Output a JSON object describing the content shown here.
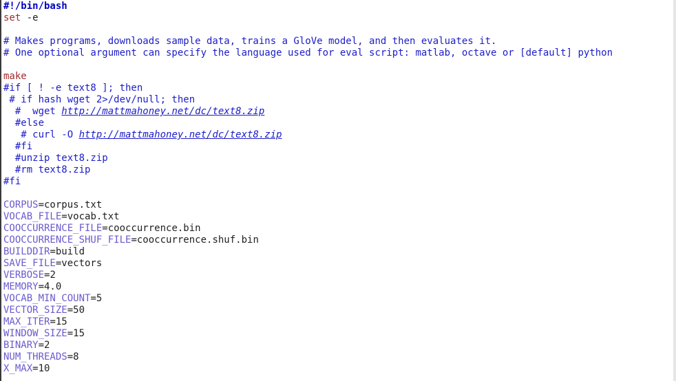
{
  "editor": {
    "lines": [
      [
        {
          "t": "#!/bin/bash",
          "c": "shebang"
        }
      ],
      [
        {
          "t": "set",
          "c": "keyword"
        },
        {
          "t": " -e",
          "c": "text"
        }
      ],
      [],
      [
        {
          "t": "# Makes programs, downloads sample data, trains a GloVe model, and then evaluates it.",
          "c": "comment"
        }
      ],
      [
        {
          "t": "# One optional argument can specify the language used for eval script: matlab, octave or [default] python",
          "c": "comment"
        }
      ],
      [],
      [
        {
          "t": "make",
          "c": "make"
        }
      ],
      [
        {
          "t": "#if [ ! -e text8 ]; then",
          "c": "comment"
        }
      ],
      [
        {
          "t": " # if hash wget 2>/dev/null; then",
          "c": "comment"
        }
      ],
      [
        {
          "t": "  #  wget ",
          "c": "comment"
        },
        {
          "t": "http://mattmahoney.net/dc/text8.zip",
          "c": "url"
        }
      ],
      [
        {
          "t": "  #else",
          "c": "comment"
        }
      ],
      [
        {
          "t": "   # curl -O ",
          "c": "comment"
        },
        {
          "t": "http://mattmahoney.net/dc/text8.zip",
          "c": "url"
        }
      ],
      [
        {
          "t": "  #fi",
          "c": "comment"
        }
      ],
      [
        {
          "t": "  #unzip text8.zip",
          "c": "comment"
        }
      ],
      [
        {
          "t": "  #rm text8.zip",
          "c": "comment"
        }
      ],
      [
        {
          "t": "#fi",
          "c": "comment"
        }
      ],
      [],
      [
        {
          "t": "CORPUS",
          "c": "varname"
        },
        {
          "t": "=corpus.txt",
          "c": "text"
        }
      ],
      [
        {
          "t": "VOCAB_FILE",
          "c": "varname"
        },
        {
          "t": "=vocab.txt",
          "c": "text"
        }
      ],
      [
        {
          "t": "COOCCURRENCE_FILE",
          "c": "varname"
        },
        {
          "t": "=cooccurrence.bin",
          "c": "text"
        }
      ],
      [
        {
          "t": "COOCCURRENCE_SHUF_FILE",
          "c": "varname"
        },
        {
          "t": "=cooccurrence.shuf.bin",
          "c": "text"
        }
      ],
      [
        {
          "t": "BUILDDIR",
          "c": "varname"
        },
        {
          "t": "=build",
          "c": "text"
        }
      ],
      [
        {
          "t": "SAVE_FILE",
          "c": "varname"
        },
        {
          "t": "=vectors",
          "c": "text"
        }
      ],
      [
        {
          "t": "VERBOSE",
          "c": "varname"
        },
        {
          "t": "=2",
          "c": "text"
        }
      ],
      [
        {
          "t": "MEMORY",
          "c": "varname"
        },
        {
          "t": "=4.0",
          "c": "text"
        }
      ],
      [
        {
          "t": "VOCAB_MIN_COUNT",
          "c": "varname"
        },
        {
          "t": "=5",
          "c": "text"
        }
      ],
      [
        {
          "t": "VECTOR_SIZE",
          "c": "varname"
        },
        {
          "t": "=50",
          "c": "text"
        }
      ],
      [
        {
          "t": "MAX_ITER",
          "c": "varname"
        },
        {
          "t": "=15",
          "c": "text"
        }
      ],
      [
        {
          "t": "WINDOW_SIZE",
          "c": "varname"
        },
        {
          "t": "=15",
          "c": "text"
        }
      ],
      [
        {
          "t": "BINARY",
          "c": "varname"
        },
        {
          "t": "=2",
          "c": "text"
        }
      ],
      [
        {
          "t": "NUM_THREADS",
          "c": "varname"
        },
        {
          "t": "=8",
          "c": "text"
        }
      ],
      [
        {
          "t": "X_MAX",
          "c": "varname"
        },
        {
          "t": "=10",
          "c": "text"
        }
      ]
    ]
  },
  "colors": {
    "background": "#ffffff",
    "comment": "#1c1cc8",
    "keyword": "#a52a2a",
    "varname": "#6a5acd",
    "text": "#1e1e1e",
    "shebang": "#0000c0"
  }
}
